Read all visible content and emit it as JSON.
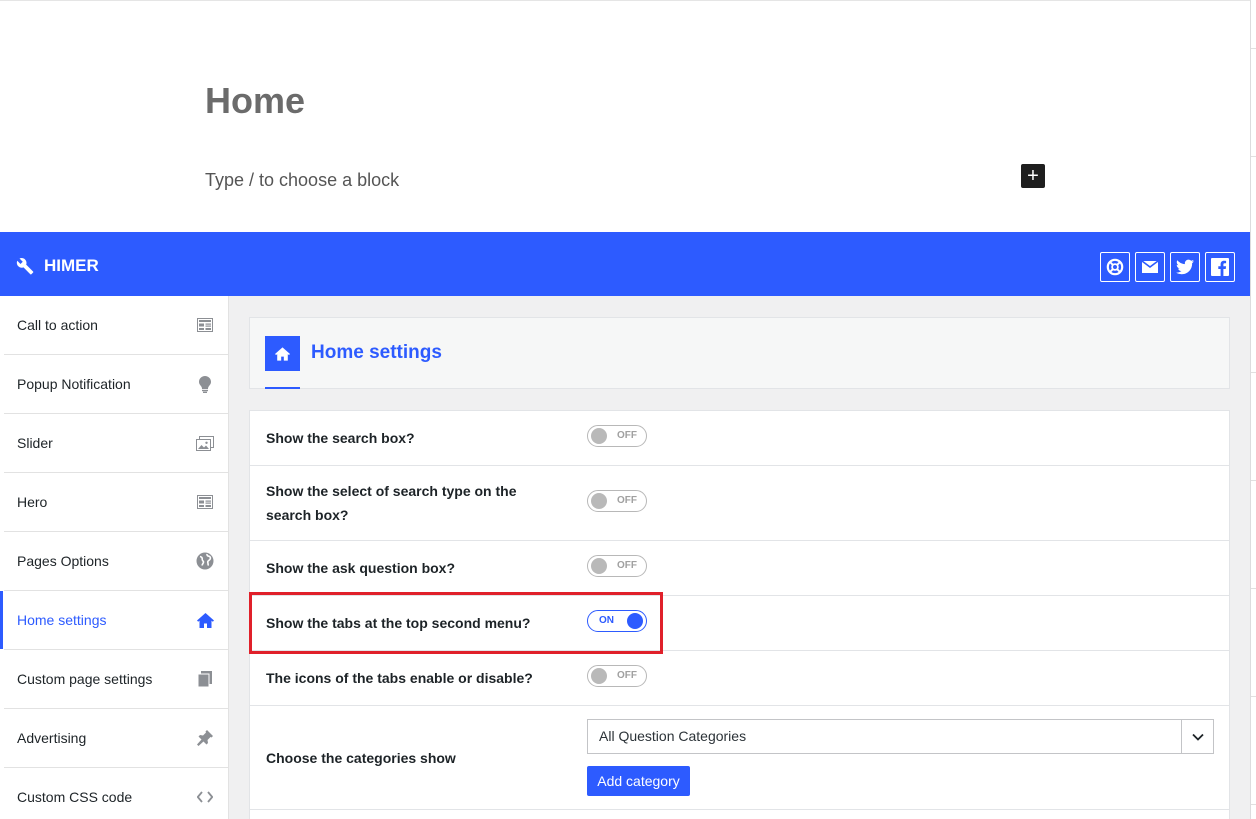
{
  "editor": {
    "title": "Home",
    "placeholder": "Type / to choose a block",
    "add_block_symbol": "+"
  },
  "header": {
    "brand": "HIMER",
    "icons": [
      "support-icon",
      "mail-icon",
      "twitter-icon",
      "facebook-icon"
    ],
    "accent": "#2d5bff"
  },
  "sidebar": {
    "items": [
      {
        "label": "Call to action",
        "icon": "layout-icon"
      },
      {
        "label": "Popup Notification",
        "icon": "lightbulb-icon"
      },
      {
        "label": "Slider",
        "icon": "images-icon"
      },
      {
        "label": "Hero",
        "icon": "layout-icon"
      },
      {
        "label": "Pages Options",
        "icon": "globe-icon"
      },
      {
        "label": "Home settings",
        "icon": "home-icon",
        "active": true
      },
      {
        "label": "Custom page settings",
        "icon": "pages-icon"
      },
      {
        "label": "Advertising",
        "icon": "pin-icon"
      },
      {
        "label": "Custom CSS code",
        "icon": "code-icon"
      }
    ]
  },
  "section": {
    "title": "Home settings"
  },
  "settings": [
    {
      "label": "Show the search box?",
      "state": "OFF"
    },
    {
      "label": "Show the select of search type on the search box?",
      "state": "OFF"
    },
    {
      "label": "Show the ask question box?",
      "state": "OFF"
    },
    {
      "label": "Show the tabs at the top second menu?",
      "state": "ON"
    },
    {
      "label": "The icons of the tabs enable or disable?",
      "state": "OFF"
    }
  ],
  "categories": {
    "label": "Choose the categories show",
    "selected": "All Question Categories",
    "add_button": "Add category"
  }
}
